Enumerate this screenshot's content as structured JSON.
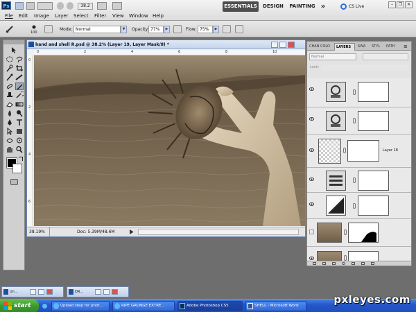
{
  "app": {
    "logo": "Ps",
    "menus": [
      "File",
      "Edit",
      "Image",
      "Layer",
      "Select",
      "Filter",
      "View",
      "Window",
      "Help"
    ],
    "zoom_control": "38.2",
    "workspaces": [
      "ESSENTIALS",
      "DESIGN",
      "PAINTING"
    ],
    "more_label": "»",
    "cs_live": "CS Live"
  },
  "options": {
    "brush_size": "100",
    "mode_label": "Mode:",
    "mode_value": "Normal",
    "opacity_label": "Opacity:",
    "opacity_value": "77%",
    "flow_label": "Flow:",
    "flow_value": "75%"
  },
  "document": {
    "title": "hand and shell R.psd @ 38.2% (Layer 19, Layer Mask/8) *",
    "zoom": "38.19%",
    "doc_info": "Doc: 5.39M/48.6M",
    "ruler_h": [
      "0",
      "2",
      "4",
      "6",
      "8",
      "10"
    ],
    "ruler_v": [
      "0",
      "2",
      "4",
      "6"
    ]
  },
  "layers_panel": {
    "tabs": [
      "CHAN COLO",
      "LAYERS",
      "SWA",
      "STYL",
      "PATH"
    ],
    "active_tab": "LAYERS",
    "blend_mode": "Normal",
    "lock_label": "Lock:",
    "layers": [
      {
        "name": "",
        "thumb": "adjust"
      },
      {
        "name": "",
        "thumb": "adjust"
      },
      {
        "name": "Layer 18",
        "thumb": "transparent"
      },
      {
        "name": "",
        "thumb": "levels"
      },
      {
        "name": "",
        "thumb": "curves"
      },
      {
        "name": "",
        "thumb": "photo-mask"
      },
      {
        "name": "",
        "thumb": "photo"
      }
    ]
  },
  "minimized_docs": [
    {
      "label": "Un..."
    },
    {
      "label": "DR..."
    }
  ],
  "taskbar": {
    "start_label": "start",
    "items": [
      {
        "label": "Upload step for phot...",
        "active": false
      },
      {
        "label": "RIPE GRUNGE EXTRE...",
        "active": false
      },
      {
        "label": "Adobe Photoshop CS5",
        "active": true
      },
      {
        "label": "SHELL - Microsoft Word",
        "active": false
      }
    ]
  },
  "watermark": "pxleyes.com"
}
